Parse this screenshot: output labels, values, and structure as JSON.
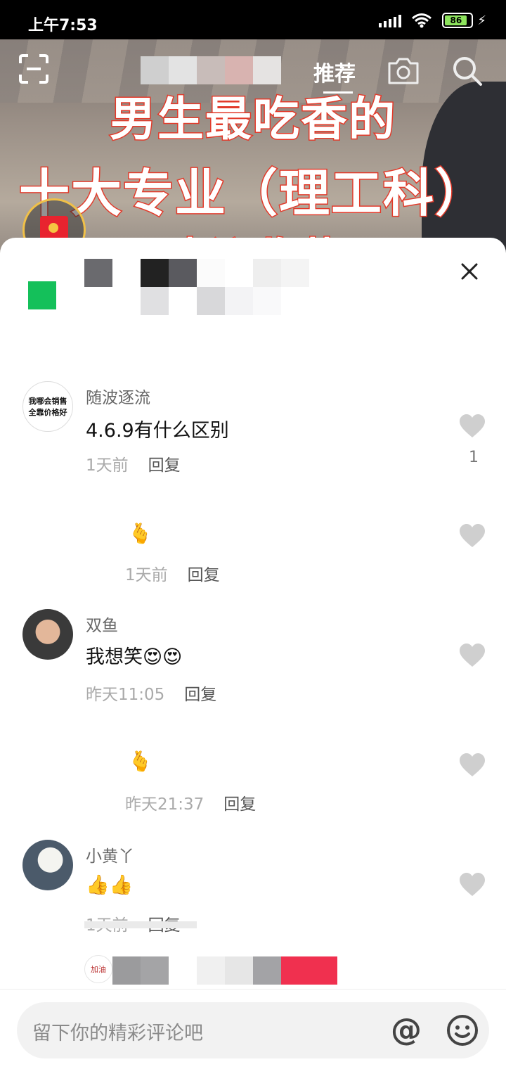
{
  "status_bar": {
    "time": "上午7:53",
    "battery": "86"
  },
  "top_nav": {
    "tab_recommended": "推荐"
  },
  "video": {
    "overlay_line1": "男生最吃香的",
    "overlay_line2": "十大专业（理工科）",
    "overlay_line3": "建议收藏"
  },
  "comments": [
    {
      "username": "随波逐流",
      "avatar_text_line1": "我哪会销售",
      "avatar_text_line2": "全靠价格好",
      "text": "4.6.9有什么区别",
      "time": "1天前",
      "reply": "回复",
      "likes": "1"
    },
    {
      "time": "1天前",
      "reply": "回复"
    },
    {
      "username": "双鱼",
      "text": "我想笑",
      "time": "昨天11:05",
      "reply": "回复"
    },
    {
      "time": "昨天21:37",
      "reply": "回复"
    },
    {
      "username": "小黄丫",
      "time": "1天前",
      "reply": "回复"
    },
    {
      "avatar_text": "加油"
    }
  ],
  "input_bar": {
    "placeholder": "留下你的精彩评论吧",
    "at_symbol": "@"
  },
  "colors": {
    "accent_red": "#e8232f",
    "heart_gray": "#cfcfcf",
    "title_stroke": "#e23a2a"
  }
}
